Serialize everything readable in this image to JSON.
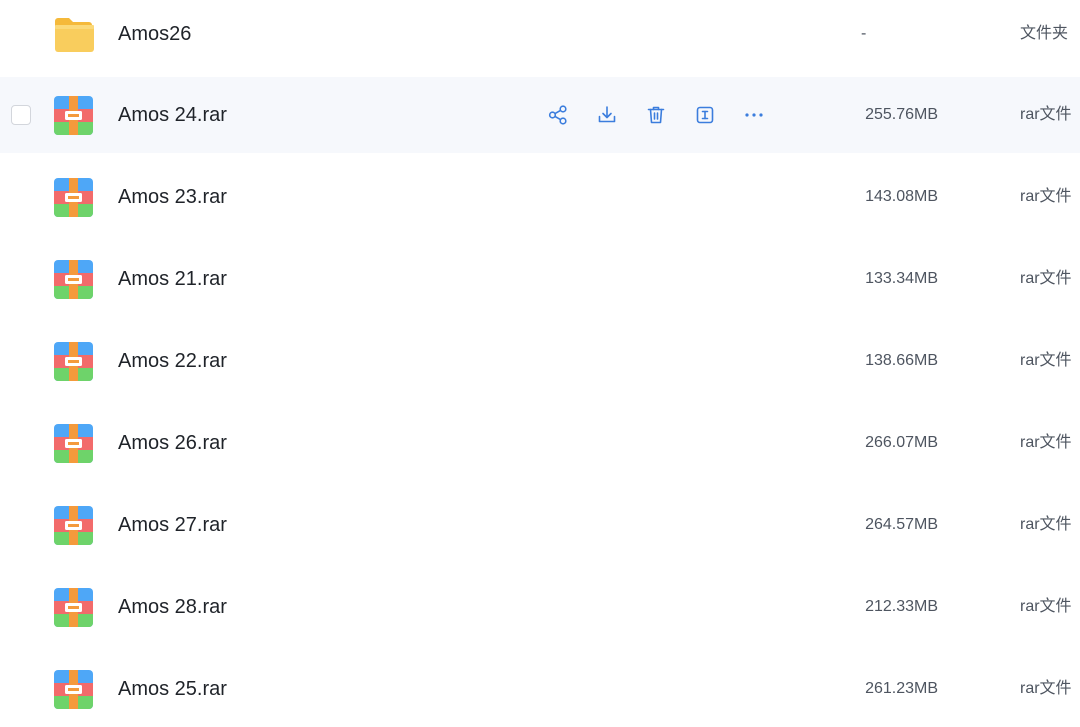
{
  "colors": {
    "accent": "#3b7ddd",
    "hover_row": "#f6f8fc",
    "folder": "#f9cd5d",
    "rar_blue": "#4ea7f7",
    "rar_red": "#f26b6b",
    "rar_green": "#6ed36a",
    "rar_orange": "#f49a3c"
  },
  "hover_actions": [
    "share-icon",
    "download-icon",
    "delete-icon",
    "rename-icon",
    "more-icon"
  ],
  "files": [
    {
      "name": "Amos26",
      "size": "-",
      "type": "文件夹",
      "icon": "folder-icon"
    },
    {
      "name": "Amos 24.rar",
      "size": "255.76MB",
      "type": "rar文件",
      "icon": "rar-archive-icon"
    },
    {
      "name": "Amos 23.rar",
      "size": "143.08MB",
      "type": "rar文件",
      "icon": "rar-archive-icon"
    },
    {
      "name": "Amos 21.rar",
      "size": "133.34MB",
      "type": "rar文件",
      "icon": "rar-archive-icon"
    },
    {
      "name": "Amos 22.rar",
      "size": "138.66MB",
      "type": "rar文件",
      "icon": "rar-archive-icon"
    },
    {
      "name": "Amos 26.rar",
      "size": "266.07MB",
      "type": "rar文件",
      "icon": "rar-archive-icon"
    },
    {
      "name": "Amos 27.rar",
      "size": "264.57MB",
      "type": "rar文件",
      "icon": "rar-archive-icon"
    },
    {
      "name": "Amos 28.rar",
      "size": "212.33MB",
      "type": "rar文件",
      "icon": "rar-archive-icon"
    },
    {
      "name": "Amos 25.rar",
      "size": "261.23MB",
      "type": "rar文件",
      "icon": "rar-archive-icon"
    }
  ]
}
